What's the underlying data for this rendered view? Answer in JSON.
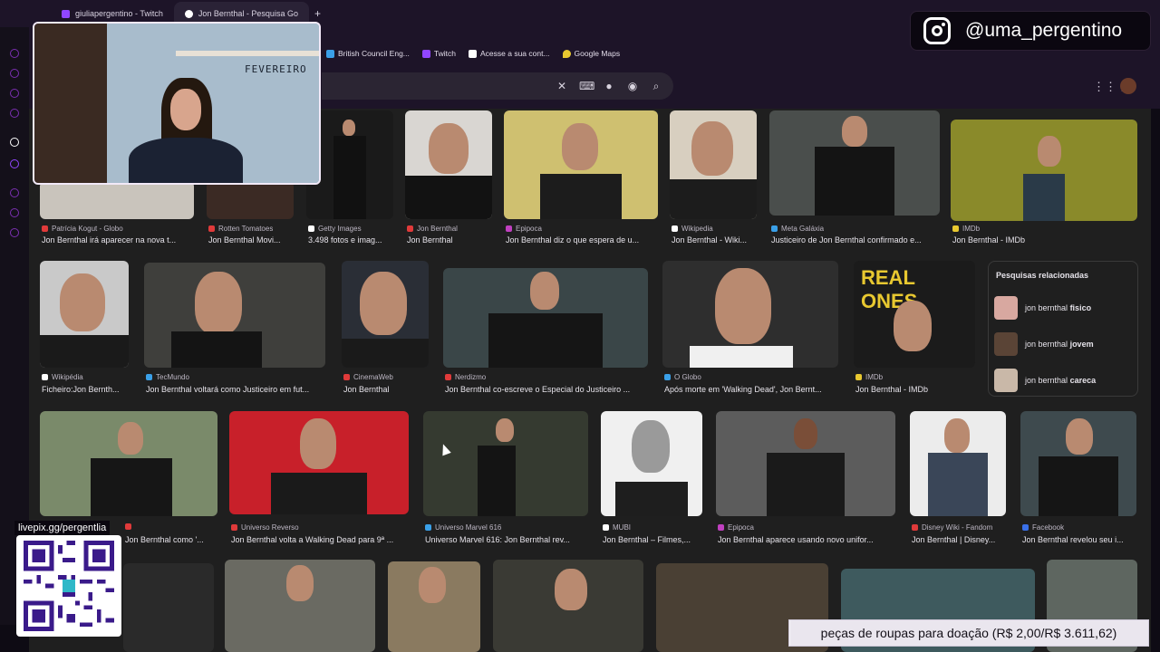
{
  "tabs": [
    {
      "label": "giuliapergentino - Twitch",
      "favicon_color": "#9146ff",
      "active": false
    },
    {
      "label": "Jon Bernthal - Pesquisa Go",
      "favicon_color": "#ffffff",
      "active": true
    }
  ],
  "new_tab_label": "+",
  "bookmarks": [
    {
      "label": "British Council Eng...",
      "icon": "british-council-icon",
      "color": "#3aa0e8"
    },
    {
      "label": "Twitch",
      "icon": "twitch-icon",
      "color": "#9146ff"
    },
    {
      "label": "Acesse a sua cont...",
      "icon": "account-icon",
      "color": "#ffffff"
    },
    {
      "label": "Google Maps",
      "icon": "map-pin-icon",
      "color": "#e8c830"
    }
  ],
  "omnibox": {
    "clear_icon": "close-icon",
    "keyboard_icon": "keyboard-icon",
    "mic_icon": "mic-icon",
    "lens_icon": "lens-icon",
    "search_icon": "search-icon"
  },
  "webcam": {
    "board_text": "FEVEREIRO"
  },
  "instagram": {
    "handle": "@uma_pergentino",
    "icon": "instagram-icon"
  },
  "qr": {
    "label": "livepix.gg/pergentlia"
  },
  "goal": {
    "text": "peças de roupas para doação (R$ 2,00/R$ 3.611,62)",
    "progress_fraction": 0.0006
  },
  "row1": [
    {
      "source": "Patrícia Kogut - Globo",
      "caption": "Jon Bernthal irá aparecer na nova t...",
      "src_color": "#e03a3a"
    },
    {
      "source": "Rotten Tomatoes",
      "caption": "Jon Bernthal Movi...",
      "src_color": "#e03a3a"
    },
    {
      "source": "Getty Images",
      "caption": "3.498 fotos e imag...",
      "src_color": "#ffffff"
    },
    {
      "source": "Jon Bernthal",
      "caption": "Jon Bernthal",
      "src_color": "#e03a3a"
    },
    {
      "source": "Epipoca",
      "caption": "Jon Bernthal diz o que espera de u...",
      "src_color": "#c040c0"
    },
    {
      "source": "Wikipedia",
      "caption": "Jon Bernthal - Wiki...",
      "src_color": "#ffffff"
    },
    {
      "source": "Meta Galáxia",
      "caption": "Justiceiro de Jon Bernthal confirmado e...",
      "src_color": "#3aa0e8"
    },
    {
      "source": "IMDb",
      "caption": "Jon Bernthal - IMDb",
      "src_color": "#e8c830"
    }
  ],
  "row2": [
    {
      "source": "Wikipédia",
      "caption": "Ficheiro:Jon Bernth...",
      "src_color": "#ffffff"
    },
    {
      "source": "TecMundo",
      "caption": "Jon Bernthal voltará como Justiceiro em fut...",
      "src_color": "#3aa0e8"
    },
    {
      "source": "CinemaWeb",
      "caption": "Jon Bernthal",
      "src_color": "#e03a3a"
    },
    {
      "source": "Nerdizmo",
      "caption": "Jon Bernthal co-escreve o Especial do Justiceiro ...",
      "src_color": "#e03a3a"
    },
    {
      "source": "O Globo",
      "caption": "Após morte em 'Walking Dead', Jon Bernt...",
      "src_color": "#3aa0e8"
    },
    {
      "source": "IMDb",
      "caption": "Jon Bernthal - IMDb",
      "src_color": "#e8c830"
    }
  ],
  "related": {
    "title": "Pesquisas relacionadas",
    "items": [
      {
        "prefix": "jon bernthal",
        "bold": "fisico"
      },
      {
        "prefix": "jon bernthal",
        "bold": "jovem"
      },
      {
        "prefix": "jon bernthal",
        "bold": "careca"
      }
    ]
  },
  "row3": [
    {
      "source": "",
      "caption": "Jon Bernthal como '...",
      "src_color": "#e03a3a"
    },
    {
      "source": "Universo Reverso",
      "caption": "Jon Bernthal volta a Walking Dead para 9ª ...",
      "src_color": "#e03a3a"
    },
    {
      "source": "Universo Marvel 616",
      "caption": "Universo Marvel 616: Jon Bernthal rev...",
      "src_color": "#3aa0e8"
    },
    {
      "source": "MUBI",
      "caption": "Jon Bernthal – Filmes,...",
      "src_color": "#ffffff"
    },
    {
      "source": "Epipoca",
      "caption": "Jon Bernthal aparece usando novo unifor...",
      "src_color": "#c040c0"
    },
    {
      "source": "Disney Wiki - Fandom",
      "caption": "Jon Bernthal | Disney...",
      "src_color": "#e03a3a"
    },
    {
      "source": "Facebook",
      "caption": "Jon Bernthal revelou seu i...",
      "src_color": "#3a70e8"
    }
  ],
  "colors": {
    "accent": "#7a2fb0",
    "background": "#1f1f1f"
  }
}
